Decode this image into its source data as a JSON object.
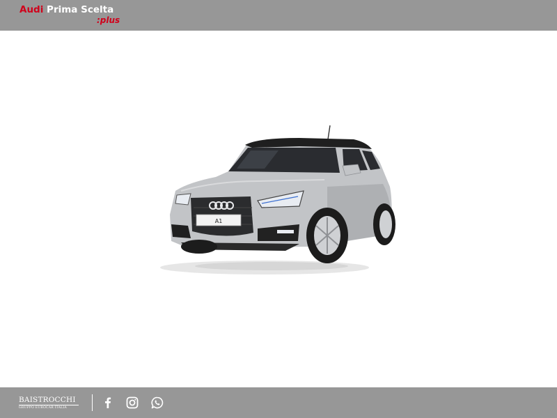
{
  "header": {
    "brand_audi": "Audi",
    "brand_rest": " Prima Scelta",
    "brand_plus": ":plus"
  },
  "car": {
    "model_badge": "A1"
  },
  "footer": {
    "dealer_name": "BAISTROCCHI",
    "dealer_subtitle": "GRUPPO EUROCAR ITALIA",
    "social_icons": [
      "facebook-icon",
      "instagram-icon",
      "whatsapp-icon"
    ]
  },
  "colors": {
    "bar": "#979797",
    "brand_red": "#d0011b",
    "car_silver": "#c2c4c7"
  }
}
